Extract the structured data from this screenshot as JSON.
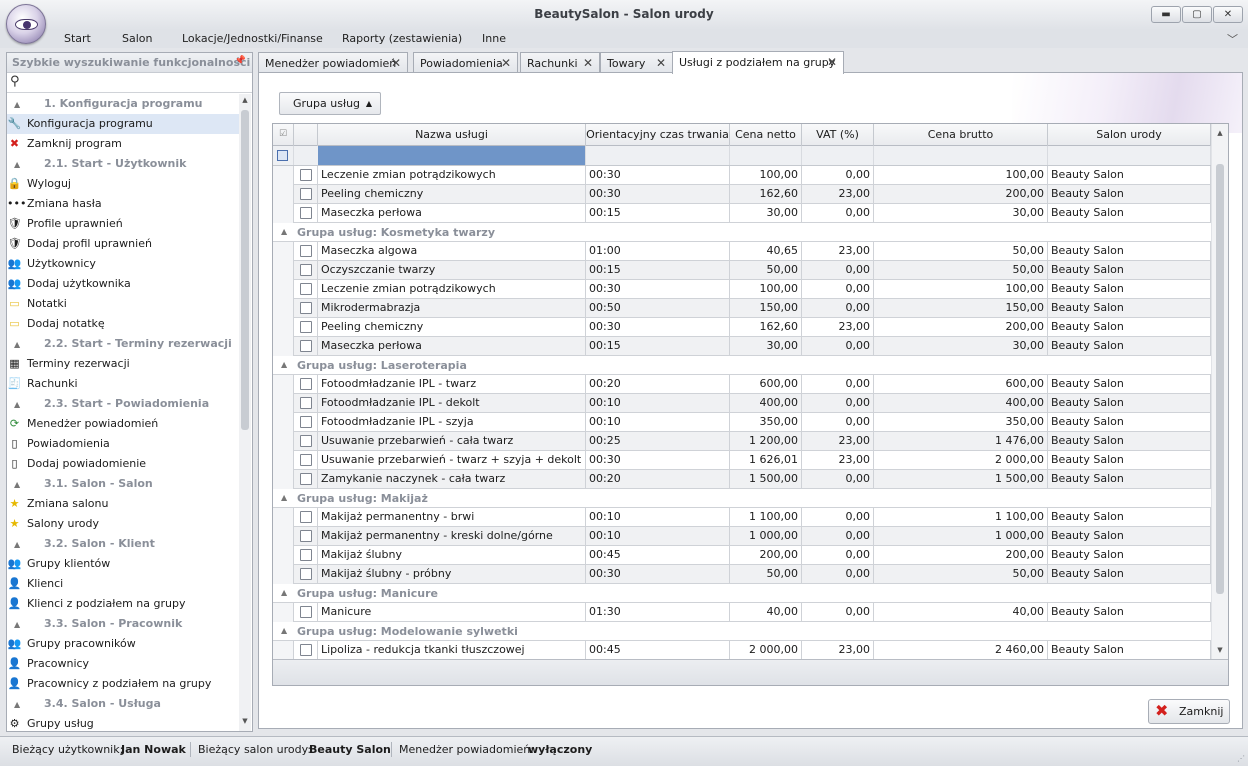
{
  "window": {
    "title": "BeautySalon - Salon urody"
  },
  "menu": [
    "Start",
    "Salon",
    "Lokacje/Jednostki/Finanse",
    "Raporty (zestawienia)",
    "Inne"
  ],
  "sidebar": {
    "title": "Szybkie wyszukiwanie funkcjonalności",
    "entries": [
      {
        "kind": "group",
        "label": "1. Konfiguracja programu"
      },
      {
        "kind": "item",
        "label": "Konfiguracja programu",
        "icon": "tools-icon",
        "glyph": "🔧",
        "selected": true
      },
      {
        "kind": "item",
        "label": "Zamknij program",
        "icon": "close-circle-icon",
        "glyph": "✖",
        "color": "#d3201d"
      },
      {
        "kind": "group",
        "label": "2.1. Start - Użytkownik"
      },
      {
        "kind": "item",
        "label": "Wyloguj",
        "icon": "lock-icon",
        "glyph": "🔒"
      },
      {
        "kind": "item",
        "label": "Zmiana hasła",
        "icon": "password-icon",
        "glyph": "•••"
      },
      {
        "kind": "item",
        "label": "Profile uprawnień",
        "icon": "shield-icon",
        "glyph": "🛡"
      },
      {
        "kind": "item",
        "label": "Dodaj profil uprawnień",
        "icon": "shield-add-icon",
        "glyph": "🛡"
      },
      {
        "kind": "item",
        "label": "Użytkownicy",
        "icon": "users-icon",
        "glyph": "👥"
      },
      {
        "kind": "item",
        "label": "Dodaj użytkownika",
        "icon": "user-add-icon",
        "glyph": "👥"
      },
      {
        "kind": "item",
        "label": "Notatki",
        "icon": "note-icon",
        "glyph": "▭",
        "color": "#e8c23a"
      },
      {
        "kind": "item",
        "label": "Dodaj notatkę",
        "icon": "note-add-icon",
        "glyph": "▭",
        "color": "#e8c23a"
      },
      {
        "kind": "group",
        "label": "2.2. Start - Terminy rezerwacji"
      },
      {
        "kind": "item",
        "label": "Terminy rezerwacji",
        "icon": "calendar-icon",
        "glyph": "▦"
      },
      {
        "kind": "item",
        "label": "Rachunki",
        "icon": "receipt-icon",
        "glyph": "🧾"
      },
      {
        "kind": "group",
        "label": "2.3. Start - Powiadomienia"
      },
      {
        "kind": "item",
        "label": "Menedżer powiadomień",
        "icon": "notification-manager-icon",
        "glyph": "⟳",
        "color": "#2e8b3a"
      },
      {
        "kind": "item",
        "label": "Powiadomienia",
        "icon": "phone-icon",
        "glyph": "▯"
      },
      {
        "kind": "item",
        "label": "Dodaj powiadomienie",
        "icon": "phone-add-icon",
        "glyph": "▯"
      },
      {
        "kind": "group",
        "label": "3.1. Salon - Salon"
      },
      {
        "kind": "item",
        "label": "Zmiana salonu",
        "icon": "star-icon",
        "glyph": "★",
        "color": "#e6b800"
      },
      {
        "kind": "item",
        "label": "Salony urody",
        "icon": "star-small-icon",
        "glyph": "★",
        "color": "#e6b800"
      },
      {
        "kind": "group",
        "label": "3.2. Salon - Klient"
      },
      {
        "kind": "item",
        "label": "Grupy klientów",
        "icon": "client-group-icon",
        "glyph": "👥"
      },
      {
        "kind": "item",
        "label": "Klienci",
        "icon": "client-icon",
        "glyph": "👤"
      },
      {
        "kind": "item",
        "label": "Klienci z podziałem na grupy",
        "icon": "client-split-icon",
        "glyph": "👤"
      },
      {
        "kind": "group",
        "label": "3.3. Salon - Pracownik"
      },
      {
        "kind": "item",
        "label": "Grupy pracowników",
        "icon": "employee-group-icon",
        "glyph": "👥"
      },
      {
        "kind": "item",
        "label": "Pracownicy",
        "icon": "employee-icon",
        "glyph": "👤"
      },
      {
        "kind": "item",
        "label": "Pracownicy z podziałem na grupy",
        "icon": "employee-split-icon",
        "glyph": "👤"
      },
      {
        "kind": "group",
        "label": "3.4. Salon - Usługa"
      },
      {
        "kind": "item",
        "label": "Grupy usług",
        "icon": "service-group-icon",
        "glyph": "⚙"
      }
    ]
  },
  "tabs": [
    {
      "label": "Menedżer powiadomień",
      "closable": true,
      "active": false
    },
    {
      "label": "Powiadomienia",
      "closable": true,
      "active": false
    },
    {
      "label": "Rachunki",
      "closable": true,
      "active": false
    },
    {
      "label": "Towary",
      "closable": true,
      "active": false
    },
    {
      "label": "Usługi z podziałem na grupy",
      "closable": true,
      "active": true
    }
  ],
  "toolbar": {
    "group_button": "Grupa usług"
  },
  "grid": {
    "columns": [
      "Nazwa usługi",
      "Orientacyjny czas trwania",
      "Cena netto",
      "VAT (%)",
      "Cena brutto",
      "Salon urody"
    ],
    "rows": [
      {
        "type": "data",
        "cells": [
          "Leczenie zmian potrądzikowych",
          "00:30",
          "100,00",
          "0,00",
          "100,00",
          "Beauty Salon"
        ]
      },
      {
        "type": "data",
        "cells": [
          "Peeling chemiczny",
          "00:30",
          "162,60",
          "23,00",
          "200,00",
          "Beauty Salon"
        ]
      },
      {
        "type": "data",
        "cells": [
          "Maseczka perłowa",
          "00:15",
          "30,00",
          "0,00",
          "30,00",
          "Beauty Salon"
        ]
      },
      {
        "type": "group",
        "label": "Grupa usług: Kosmetyka twarzy"
      },
      {
        "type": "data",
        "cells": [
          "Maseczka algowa",
          "01:00",
          "40,65",
          "23,00",
          "50,00",
          "Beauty Salon"
        ]
      },
      {
        "type": "data",
        "cells": [
          "Oczyszczanie twarzy",
          "00:15",
          "50,00",
          "0,00",
          "50,00",
          "Beauty Salon"
        ]
      },
      {
        "type": "data",
        "cells": [
          "Leczenie zmian potrądzikowych",
          "00:30",
          "100,00",
          "0,00",
          "100,00",
          "Beauty Salon"
        ]
      },
      {
        "type": "data",
        "cells": [
          "Mikrodermabrazja",
          "00:50",
          "150,00",
          "0,00",
          "150,00",
          "Beauty Salon"
        ]
      },
      {
        "type": "data",
        "cells": [
          "Peeling chemiczny",
          "00:30",
          "162,60",
          "23,00",
          "200,00",
          "Beauty Salon"
        ]
      },
      {
        "type": "data",
        "cells": [
          "Maseczka perłowa",
          "00:15",
          "30,00",
          "0,00",
          "30,00",
          "Beauty Salon"
        ]
      },
      {
        "type": "group",
        "label": "Grupa usług: Laseroterapia"
      },
      {
        "type": "data",
        "cells": [
          "Fotoodmładzanie IPL - twarz",
          "00:20",
          "600,00",
          "0,00",
          "600,00",
          "Beauty Salon"
        ]
      },
      {
        "type": "data",
        "cells": [
          "Fotoodmładzanie IPL - dekolt",
          "00:10",
          "400,00",
          "0,00",
          "400,00",
          "Beauty Salon"
        ]
      },
      {
        "type": "data",
        "cells": [
          "Fotoodmładzanie IPL - szyja",
          "00:10",
          "350,00",
          "0,00",
          "350,00",
          "Beauty Salon"
        ]
      },
      {
        "type": "data",
        "cells": [
          "Usuwanie przebarwień - cała twarz",
          "00:25",
          "1 200,00",
          "23,00",
          "1 476,00",
          "Beauty Salon"
        ]
      },
      {
        "type": "data",
        "cells": [
          "Usuwanie przebarwień - twarz + szyja + dekolt",
          "00:30",
          "1 626,01",
          "23,00",
          "2 000,00",
          "Beauty Salon"
        ]
      },
      {
        "type": "data",
        "cells": [
          "Zamykanie naczynek - cała twarz",
          "00:20",
          "1 500,00",
          "0,00",
          "1 500,00",
          "Beauty Salon"
        ]
      },
      {
        "type": "group",
        "label": "Grupa usług: Makijaż"
      },
      {
        "type": "data",
        "cells": [
          "Makijaż permanentny - brwi",
          "00:10",
          "1 100,00",
          "0,00",
          "1 100,00",
          "Beauty Salon"
        ]
      },
      {
        "type": "data",
        "cells": [
          "Makijaż permanentny - kreski dolne/górne",
          "00:10",
          "1 000,00",
          "0,00",
          "1 000,00",
          "Beauty Salon"
        ]
      },
      {
        "type": "data",
        "cells": [
          "Makijaż ślubny",
          "00:45",
          "200,00",
          "0,00",
          "200,00",
          "Beauty Salon"
        ]
      },
      {
        "type": "data",
        "cells": [
          "Makijaż ślubny - próbny",
          "00:30",
          "50,00",
          "0,00",
          "50,00",
          "Beauty Salon"
        ]
      },
      {
        "type": "group",
        "label": "Grupa usług: Manicure"
      },
      {
        "type": "data",
        "cells": [
          "Manicure",
          "01:30",
          "40,00",
          "0,00",
          "40,00",
          "Beauty Salon"
        ]
      },
      {
        "type": "group",
        "label": "Grupa usług: Modelowanie sylwetki"
      },
      {
        "type": "data",
        "cells": [
          "Lipoliza - redukcja tkanki tłuszczowej",
          "00:45",
          "2 000,00",
          "23,00",
          "2 460,00",
          "Beauty Salon"
        ]
      }
    ]
  },
  "close_button": "Zamknij",
  "status": {
    "user_label": "Bieżący użytkownik:",
    "user_value": "Jan Nowak",
    "salon_label": "Bieżący salon urody:",
    "salon_value": "Beauty Salon",
    "notif_label": "Menedżer powiadomień:",
    "notif_value": "wyłączony"
  }
}
